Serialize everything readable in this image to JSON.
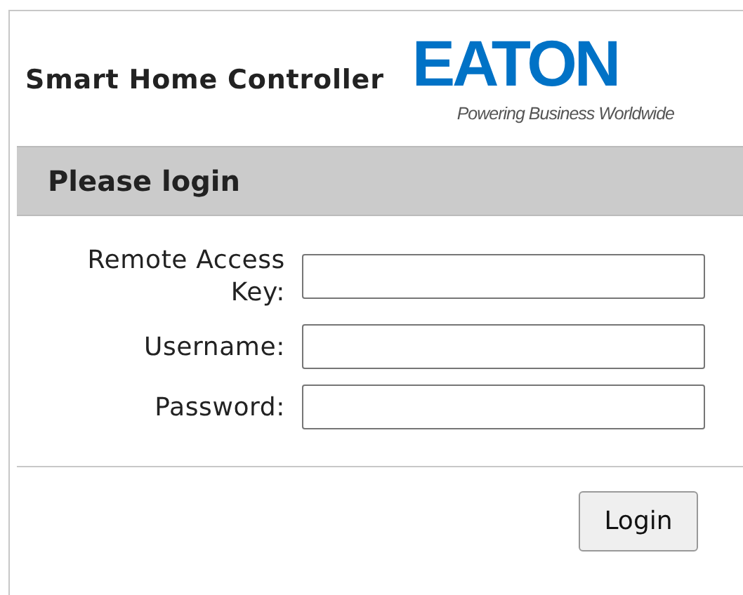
{
  "header": {
    "title": "Smart Home Controller",
    "logo": {
      "wordmark": "EATON",
      "tagline": "Powering Business Worldwide"
    }
  },
  "panel": {
    "heading": "Please login"
  },
  "fields": [
    {
      "label": "Remote Access Key:"
    },
    {
      "label": "Username:"
    },
    {
      "label": "Password:"
    }
  ],
  "buttons": [
    "Login"
  ]
}
